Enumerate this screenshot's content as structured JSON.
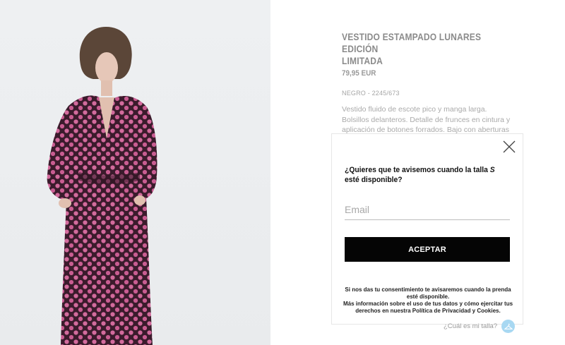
{
  "product": {
    "title_line1": "VESTIDO ESTAMPADO LUNARES EDICIÓN",
    "title_line2": "LIMITADA",
    "price": "79,95 EUR",
    "reference": "NEGRO - 2245/673",
    "description": "Vestido fluido de escote pico y manga larga. Bolsillos delanteros. Detalle de frunces en cintura y aplicación de botones forrados. Bajo con aberturas frontales. Cierre lateral con cremallera oculta en costura y cinturón del mismo tejido con hebilla forrada."
  },
  "notify_modal": {
    "question_before": "¿Quieres que te avisemos cuando la talla ",
    "size": "S",
    "question_after": " esté disponible?",
    "email_placeholder": "Email",
    "email_value": "",
    "accept_label": "ACEPTAR",
    "legal_line1": "Si nos das tu consentimiento te avisaremos cuando la prenda esté disponible.",
    "legal_line2": "Más información sobre el uso de tus datos y cómo ejercitar tus derechos en nuestra Política de Privacidad y Cookies."
  },
  "size_guide": {
    "label": "¿Cuál es mi talla?"
  },
  "icons": {
    "close": "close-icon",
    "size_guide": "hanger-icon"
  },
  "colors": {
    "button_bg": "#050505",
    "dress_base": "#3a1a2a",
    "dots": "#d4689a",
    "size_icon_bg": "#a8d8f2"
  }
}
